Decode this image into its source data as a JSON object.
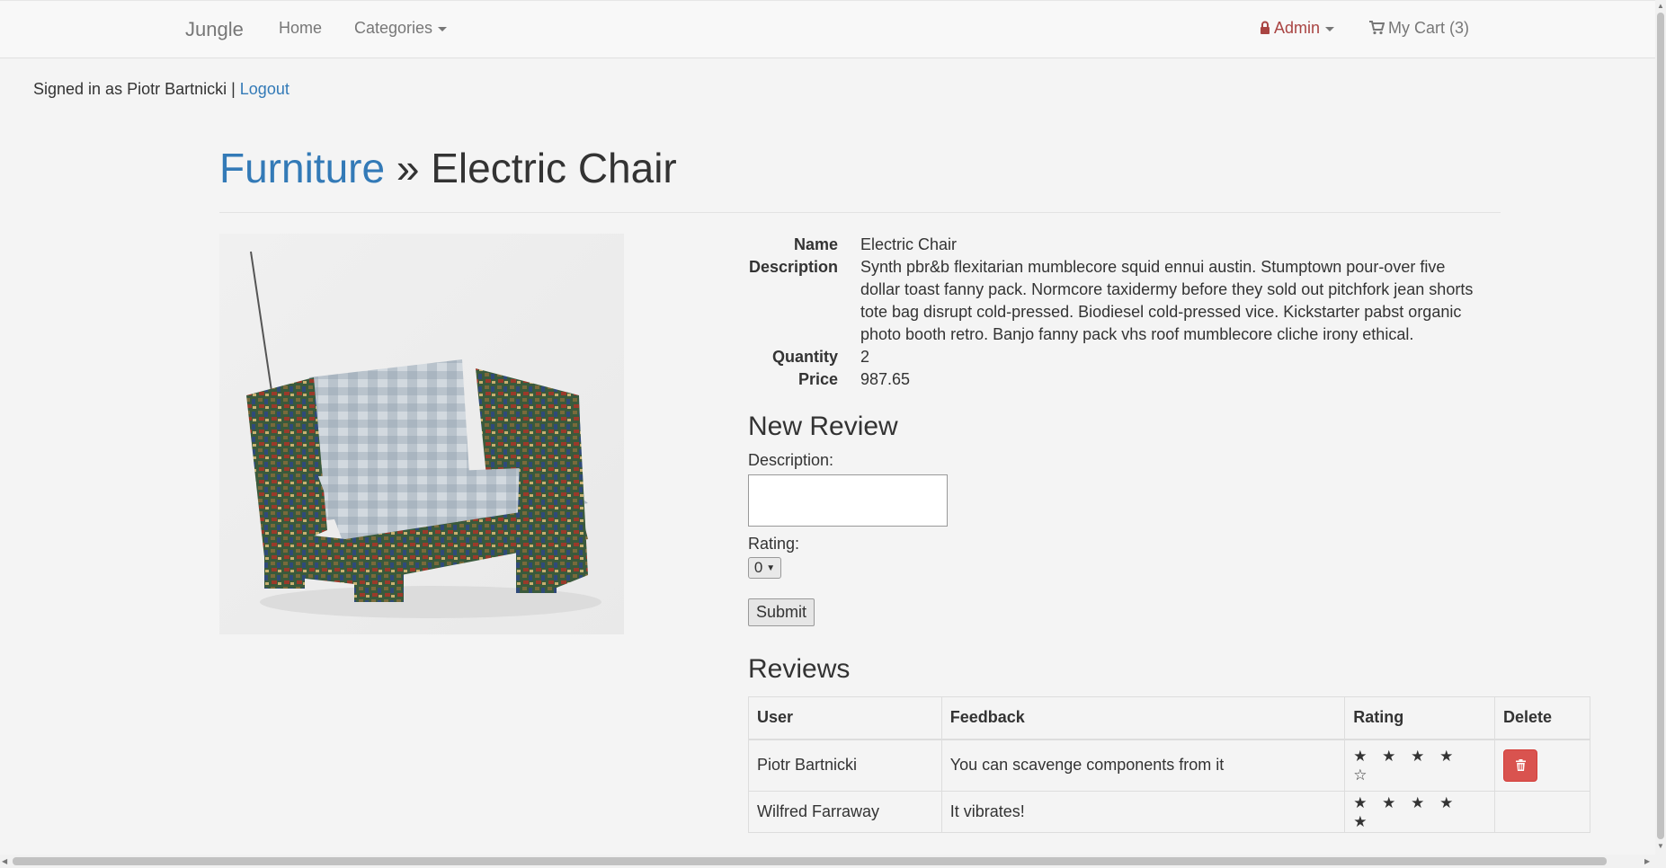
{
  "navbar": {
    "brand": "Jungle",
    "home": "Home",
    "categories": "Categories",
    "admin": "Admin",
    "cart": "My Cart (3)"
  },
  "session": {
    "signed_in_text": "Signed in as Piotr Bartnicki | ",
    "logout": "Logout"
  },
  "header": {
    "category": "Furniture",
    "separator": " » ",
    "product": "Electric Chair"
  },
  "product": {
    "labels": {
      "name": "Name",
      "description": "Description",
      "quantity": "Quantity",
      "price": "Price"
    },
    "name": "Electric Chair",
    "description": "Synth pbr&b flexitarian mumblecore squid ennui austin. Stumptown pour-over five dollar toast fanny pack. Normcore taxidermy before they sold out pitchfork jean shorts tote bag disrupt cold-pressed. Biodiesel cold-pressed vice. Kickstarter pabst organic photo booth retro. Banjo fanny pack vhs roof mumblecore cliche irony ethical.",
    "quantity": "2",
    "price": "987.65"
  },
  "new_review": {
    "title": "New Review",
    "description_label": "Description:",
    "description_value": "",
    "rating_label": "Rating:",
    "rating_value": "0",
    "submit": "Submit"
  },
  "reviews": {
    "title": "Reviews",
    "columns": [
      "User",
      "Feedback",
      "Rating",
      "Delete"
    ],
    "rows": [
      {
        "user": "Piotr Bartnicki",
        "feedback": "You can scavenge components from it",
        "stars": "★ ★ ★ ★ ☆",
        "rating": 4,
        "deletable": true
      },
      {
        "user": "Wilfred Farraway",
        "feedback": "It vibrates!",
        "stars": "★ ★ ★ ★ ★",
        "rating": 5,
        "deletable": false
      }
    ]
  },
  "colors": {
    "link": "#337ab7",
    "admin": "#a94442",
    "delete_button": "#d9534f"
  }
}
